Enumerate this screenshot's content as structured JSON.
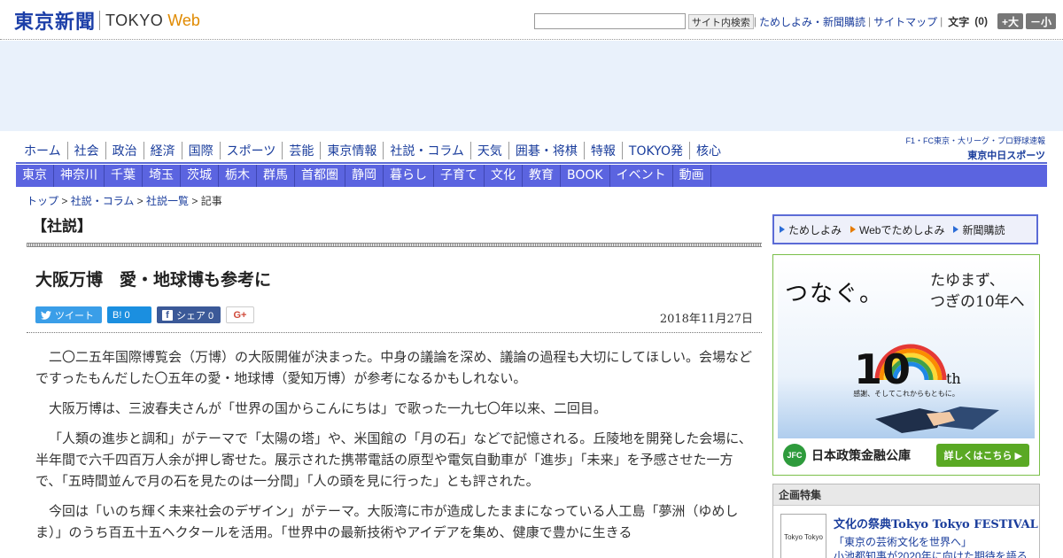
{
  "header": {
    "logo_jp": "東京新聞",
    "logo_en": "TOKYO",
    "logo_web": "Web",
    "search_button": "サイト内検索",
    "links": [
      "ためしよみ・新聞購読",
      "サイトマップ"
    ],
    "font_label": "文字",
    "font_count": "(0)",
    "font_bigger": "+大",
    "font_smaller": "－小"
  },
  "nav_primary": [
    "ホーム",
    "社会",
    "政治",
    "経済",
    "国際",
    "スポーツ",
    "芸能",
    "東京情報",
    "社説・コラム",
    "天気",
    "囲碁・将棋",
    "特報",
    "TOKYO発",
    "核心"
  ],
  "chunichi": {
    "top": "F1・FC東京・大リーグ・プロ野球速報",
    "bottom": "東京中日スポーツ"
  },
  "nav_secondary": [
    "東京",
    "神奈川",
    "千葉",
    "埼玉",
    "茨城",
    "栃木",
    "群馬",
    "首都圏",
    "静岡",
    "暮らし",
    "子育て",
    "文化",
    "教育",
    "BOOK",
    "イベント",
    "動画"
  ],
  "breadcrumb": {
    "items": [
      "トップ",
      "社説・コラム",
      "社説一覧"
    ],
    "current": "記事",
    "sep": " > "
  },
  "article": {
    "section": "【社説】",
    "title": "大阪万博　愛・地球博も参考に",
    "date": "2018年11月27日",
    "share": {
      "tweet": "ツイート",
      "hatena": "B! 0",
      "facebook": "シェア 0",
      "gplus": "G+"
    },
    "paragraphs": [
      "二〇二五年国際博覧会（万博）の大阪開催が決まった。中身の議論を深め、議論の過程も大切にしてほしい。会場などですったもんだした〇五年の愛・地球博（愛知万博）が参考になるかもしれない。",
      "大阪万博は、三波春夫さんが「世界の国からこんにちは」で歌った一九七〇年以来、二回目。",
      "「人類の進歩と調和」がテーマで「太陽の塔」や、米国館の「月の石」などで記憶される。丘陵地を開発した会場に、半年間で六千四百万人余が押し寄せた。展示された携帯電話の原型や電気自動車が「進歩」「未来」を予感させた一方で、「五時間並んで月の石を見たのは一分間」「人の頭を見に行った」とも評された。",
      "今回は「いのち輝く未来社会のデザイン」がテーマ。大阪湾に市が造成したままになっている人工島「夢洲（ゆめしま）」のうち百五十五ヘクタールを活用。「世界中の最新技術やアイデアを集め、健康で豊かに生きる"
    ]
  },
  "sidebar": {
    "buttons": [
      "ためしよみ",
      "Webでためしよみ",
      "新聞購読"
    ],
    "ad": {
      "slogan": "つなぐ。",
      "sub": [
        "たゆまず、",
        "つぎの10年へ"
      ],
      "logo_num": "10",
      "logo_suffix": "th",
      "tagline": "感謝、そしてこれからもともに。",
      "org_abbr": "JFC",
      "org_name": "日本政策金融公庫",
      "cta": "詳しくはこちら"
    },
    "feature": {
      "heading": "企画特集",
      "thumb_text": "Tokyo Tokyo",
      "title": "文化の祭典Tokyo Tokyo FESTIVAL",
      "sub1": "「東京の芸術文化を世界へ」",
      "sub2": "小池都知事が2020年に向けた期待を語る"
    }
  },
  "colors": {
    "brand": "#1c3fa8",
    "nav_bar": "#5b64e0",
    "web_orange": "#e08a00",
    "ad_green": "#5aa924"
  }
}
